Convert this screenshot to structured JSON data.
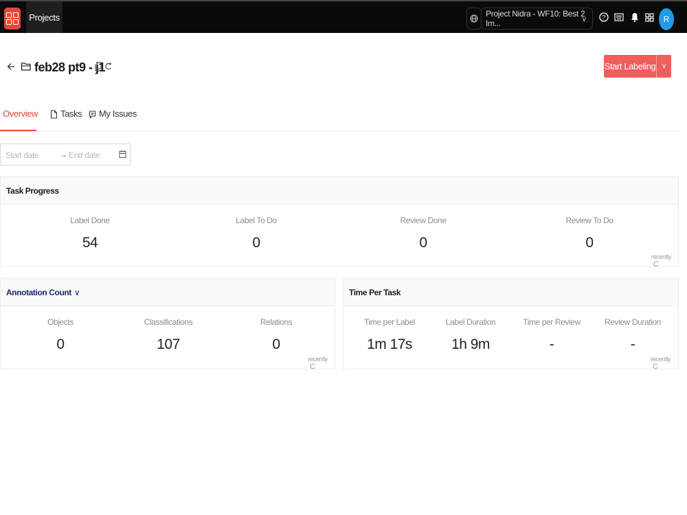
{
  "topbar": {
    "nav_projects": "Projects",
    "project_select": "Project Nidra - WF10: Best 2 Im...",
    "avatar_initial": "R"
  },
  "header": {
    "title": "feb28 pt9 - j1",
    "start_button": "Start Labeling"
  },
  "tabs": [
    {
      "label": "Overview",
      "icon": "pie-chart-icon",
      "active": true
    },
    {
      "label": "Tasks",
      "icon": "file-icon",
      "active": false
    },
    {
      "label": "My Issues",
      "icon": "issue-icon",
      "active": false
    }
  ],
  "date_range": {
    "start_placeholder": "Start date",
    "end_placeholder": "End date"
  },
  "task_progress": {
    "title": "Task Progress",
    "stats": [
      {
        "label": "Label Done",
        "value": "54"
      },
      {
        "label": "Label To Do",
        "value": "0"
      },
      {
        "label": "Review Done",
        "value": "0"
      },
      {
        "label": "Review To Do",
        "value": "0"
      }
    ],
    "updated": "recently"
  },
  "annotation_count": {
    "title": "Annotation Count",
    "stats": [
      {
        "label": "Objects",
        "value": "0"
      },
      {
        "label": "Classifications",
        "value": "107"
      },
      {
        "label": "Relations",
        "value": "0"
      }
    ],
    "updated": "recently"
  },
  "time_per_task": {
    "title": "Time Per Task",
    "stats": [
      {
        "label": "Time per Label",
        "value": "1m 17s"
      },
      {
        "label": "Label Duration",
        "value": "1h 9m"
      },
      {
        "label": "Time per Review",
        "value": "-"
      },
      {
        "label": "Review Duration",
        "value": "-"
      }
    ],
    "updated": "recently"
  },
  "colors": {
    "accent": "#e8453c",
    "button": "#ef5d5d",
    "avatar": "#1f9ce6",
    "topbar": "#0a0a0a"
  }
}
